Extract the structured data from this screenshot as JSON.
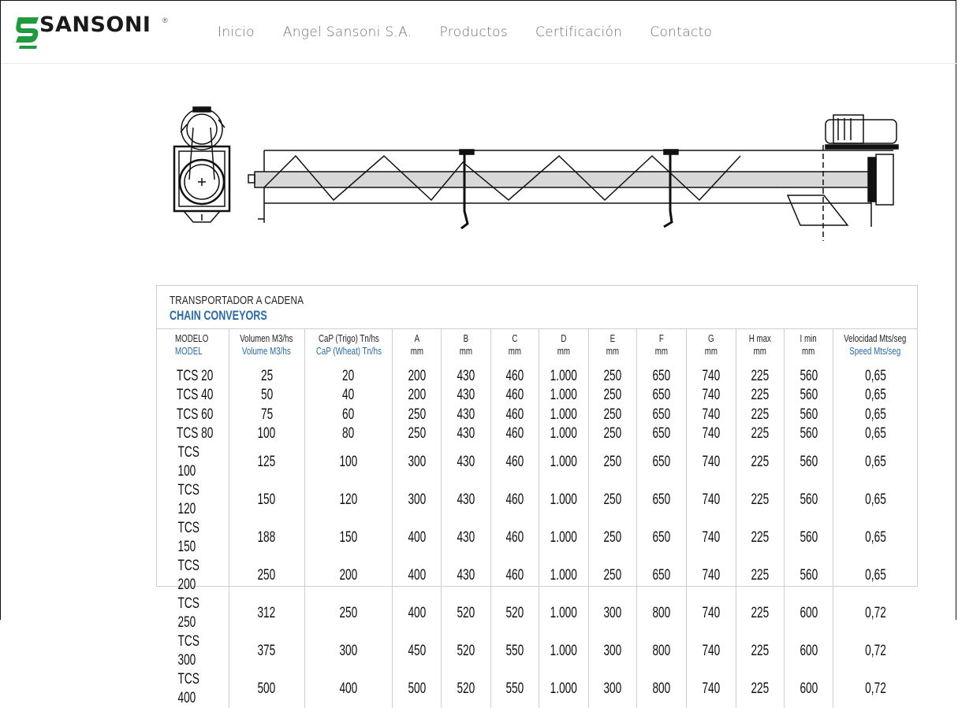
{
  "brand": {
    "name": "SANSONI",
    "reg": "®",
    "color": "#1f9a3c"
  },
  "nav": [
    "Inicio",
    "Angel Sansoni S.A.",
    "Productos",
    "Certificación",
    "Contacto"
  ],
  "table": {
    "title_es": "TRANSPORTADOR A CADENA",
    "title_en": "CHAIN CONVEYORS",
    "accent": "#2a6aa8",
    "headers": [
      {
        "es": "MODELO",
        "en": "MODEL"
      },
      {
        "es": "Volumen M3/hs",
        "en": "Volume M3/hs"
      },
      {
        "es": "CaP (Trigo) Tn/hs",
        "en": "CaP (Wheat) Tn/hs"
      },
      {
        "es": "A",
        "en": "mm"
      },
      {
        "es": "B",
        "en": "mm"
      },
      {
        "es": "C",
        "en": "mm"
      },
      {
        "es": "D",
        "en": "mm"
      },
      {
        "es": "E",
        "en": "mm"
      },
      {
        "es": "F",
        "en": "mm"
      },
      {
        "es": "G",
        "en": "mm"
      },
      {
        "es": "H max",
        "en": "mm"
      },
      {
        "es": "I min",
        "en": "mm"
      },
      {
        "es": "Velocidad Mts/seg",
        "en": "Speed Mts/seg"
      }
    ],
    "rows": [
      [
        "TCS 20",
        "25",
        "20",
        "200",
        "430",
        "460",
        "1.000",
        "250",
        "650",
        "740",
        "225",
        "560",
        "0,65"
      ],
      [
        "TCS 40",
        "50",
        "40",
        "200",
        "430",
        "460",
        "1.000",
        "250",
        "650",
        "740",
        "225",
        "560",
        "0,65"
      ],
      [
        "TCS 60",
        "75",
        "60",
        "250",
        "430",
        "460",
        "1.000",
        "250",
        "650",
        "740",
        "225",
        "560",
        "0,65"
      ],
      [
        "TCS 80",
        "100",
        "80",
        "250",
        "430",
        "460",
        "1.000",
        "250",
        "650",
        "740",
        "225",
        "560",
        "0,65"
      ],
      [
        "TCS 100",
        "125",
        "100",
        "300",
        "430",
        "460",
        "1.000",
        "250",
        "650",
        "740",
        "225",
        "560",
        "0,65"
      ],
      [
        "TCS 120",
        "150",
        "120",
        "300",
        "430",
        "460",
        "1.000",
        "250",
        "650",
        "740",
        "225",
        "560",
        "0,65"
      ],
      [
        "TCS 150",
        "188",
        "150",
        "400",
        "430",
        "460",
        "1.000",
        "250",
        "650",
        "740",
        "225",
        "560",
        "0,65"
      ],
      [
        "TCS 200",
        "250",
        "200",
        "400",
        "430",
        "460",
        "1.000",
        "250",
        "650",
        "740",
        "225",
        "560",
        "0,65"
      ],
      [
        "TCS 250",
        "312",
        "250",
        "400",
        "520",
        "520",
        "1.000",
        "300",
        "800",
        "740",
        "225",
        "600",
        "0,72"
      ],
      [
        "TCS 300",
        "375",
        "300",
        "450",
        "520",
        "550",
        "1.000",
        "300",
        "800",
        "740",
        "225",
        "600",
        "0,72"
      ],
      [
        "TCS 400",
        "500",
        "400",
        "500",
        "520",
        "550",
        "1.000",
        "300",
        "800",
        "740",
        "225",
        "600",
        "0,72"
      ]
    ]
  }
}
